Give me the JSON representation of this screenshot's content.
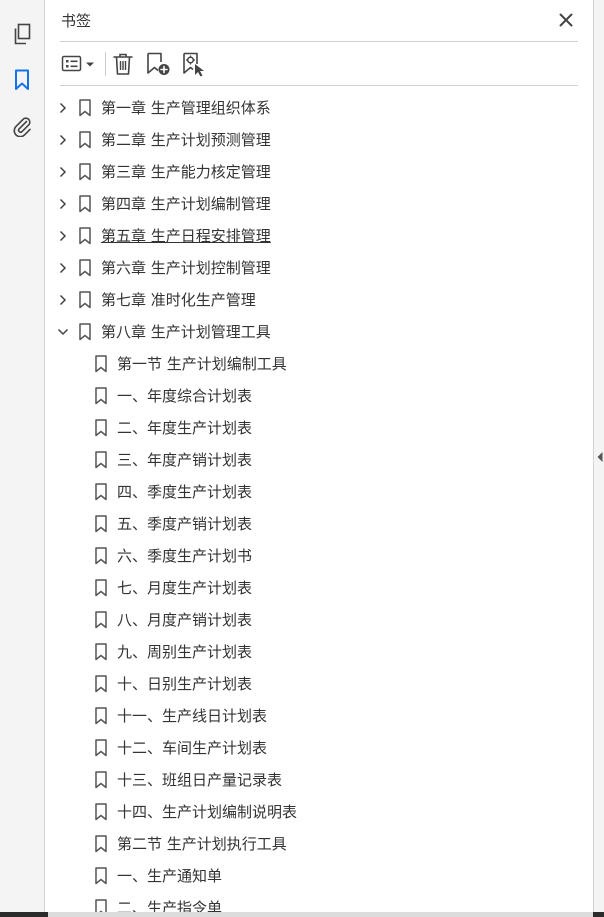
{
  "panel": {
    "title": "书签"
  },
  "colors": {
    "accent": "#1473e6",
    "icon": "#444444"
  },
  "left_toolbar": [
    {
      "name": "page-thumbnails-icon"
    },
    {
      "name": "bookmarks-icon",
      "active": true
    },
    {
      "name": "attachments-icon"
    }
  ],
  "toolbar": {
    "options": "options-menu-icon",
    "delete": "delete-icon",
    "new_bookmark": "new-bookmark-icon",
    "new_from_structure": "bookmark-from-selection-icon"
  },
  "bookmarks": [
    {
      "label": "第一章  生产管理组织体系",
      "level": 0,
      "expander": "collapsed"
    },
    {
      "label": "第二章  生产计划预测管理",
      "level": 0,
      "expander": "collapsed"
    },
    {
      "label": "第三章  生产能力核定管理",
      "level": 0,
      "expander": "collapsed"
    },
    {
      "label": "第四章  生产计划编制管理",
      "level": 0,
      "expander": "collapsed"
    },
    {
      "label": "第五章  生产日程安排管理",
      "level": 0,
      "expander": "collapsed",
      "hover": true
    },
    {
      "label": "第六章  生产计划控制管理",
      "level": 0,
      "expander": "collapsed"
    },
    {
      "label": "第七章  准时化生产管理",
      "level": 0,
      "expander": "collapsed"
    },
    {
      "label": "第八章  生产计划管理工具",
      "level": 0,
      "expander": "expanded"
    },
    {
      "label": "第一节  生产计划编制工具",
      "level": 1,
      "expander": "none"
    },
    {
      "label": "一、年度综合计划表",
      "level": 1,
      "expander": "none"
    },
    {
      "label": "二、年度生产计划表",
      "level": 1,
      "expander": "none"
    },
    {
      "label": "三、年度产销计划表",
      "level": 1,
      "expander": "none"
    },
    {
      "label": "四、季度生产计划表",
      "level": 1,
      "expander": "none"
    },
    {
      "label": "五、季度产销计划表",
      "level": 1,
      "expander": "none"
    },
    {
      "label": "六、季度生产计划书",
      "level": 1,
      "expander": "none"
    },
    {
      "label": "七、月度生产计划表",
      "level": 1,
      "expander": "none"
    },
    {
      "label": "八、月度产销计划表",
      "level": 1,
      "expander": "none"
    },
    {
      "label": "九、周别生产计划表",
      "level": 1,
      "expander": "none"
    },
    {
      "label": "十、日别生产计划表",
      "level": 1,
      "expander": "none"
    },
    {
      "label": "十一、生产线日计划表",
      "level": 1,
      "expander": "none"
    },
    {
      "label": "十二、车间生产计划表",
      "level": 1,
      "expander": "none"
    },
    {
      "label": "十三、班组日产量记录表",
      "level": 1,
      "expander": "none"
    },
    {
      "label": "十四、生产计划编制说明表",
      "level": 1,
      "expander": "none"
    },
    {
      "label": "第二节  生产计划执行工具",
      "level": 1,
      "expander": "none"
    },
    {
      "label": "一、生产通知单",
      "level": 1,
      "expander": "none"
    },
    {
      "label": "二、生产指令单",
      "level": 1,
      "expander": "none"
    }
  ]
}
